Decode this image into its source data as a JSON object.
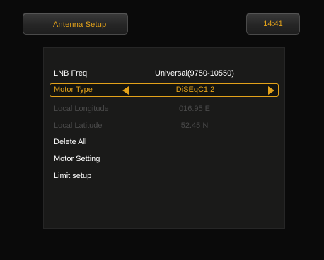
{
  "header": {
    "title": "Antenna Setup",
    "clock": "14:41"
  },
  "menu": {
    "lnb_freq": {
      "label": "LNB Freq",
      "value": "Universal(9750-10550)"
    },
    "motor_type": {
      "label": "Motor Type",
      "value": "DiSEqC1.2"
    },
    "local_longitude": {
      "label": "Local Longitude",
      "value": "016.95 E"
    },
    "local_latitude": {
      "label": "Local Latitude",
      "value": "52.45 N"
    },
    "delete_all": {
      "label": "Delete All"
    },
    "motor_setting": {
      "label": "Motor Setting"
    },
    "limit_setup": {
      "label": "Limit setup"
    }
  },
  "colors": {
    "accent": "#e3a21a",
    "text": "#ffffff",
    "disabled": "#4a4a4a",
    "panel": "#1a1a19"
  },
  "icons": {
    "left": "left-triangle-arrow",
    "right": "right-triangle-arrow"
  }
}
